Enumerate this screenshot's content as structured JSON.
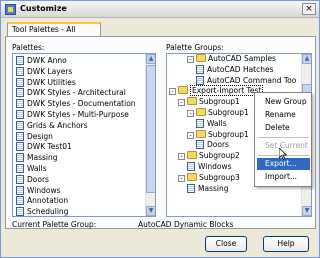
{
  "window": {
    "title": "Customize",
    "close_glyph": "×"
  },
  "tab": {
    "label": "Tool Palettes - All Palettes"
  },
  "palettes": {
    "label": "Palettes:",
    "items": [
      "DWK Anno",
      "DWK Layers",
      "DWK Utilities",
      "DWK Styles - Architectural",
      "DWK Styles - Documentation",
      "DWK Styles - Multi-Purpose",
      "Grids & Anchors",
      "Design",
      "DWK Test01",
      "Massing",
      "Walls",
      "Doors",
      "Windows",
      "Annotation",
      "Scheduling"
    ]
  },
  "groups": {
    "label": "Palette Groups:",
    "tree": [
      {
        "level": 3,
        "type": "folder",
        "expander": "-",
        "text": "AutoCAD Samples"
      },
      {
        "level": 4,
        "type": "palette",
        "text": "AutoCAD Hatches"
      },
      {
        "level": 4,
        "type": "palette",
        "text": "AutoCAD Command Too"
      },
      {
        "level": 1,
        "type": "folder",
        "expander": "-",
        "text": "Export-Import Test",
        "selected": true
      },
      {
        "level": 2,
        "type": "folder",
        "expander": "-",
        "text": "Subgroup1"
      },
      {
        "level": 3,
        "type": "folder",
        "expander": "-",
        "text": "Subgroup1"
      },
      {
        "level": 4,
        "type": "palette",
        "text": "Walls"
      },
      {
        "level": 3,
        "type": "folder",
        "expander": "-",
        "text": "Subgroup1"
      },
      {
        "level": 4,
        "type": "palette",
        "text": "Doors"
      },
      {
        "level": 2,
        "type": "folder",
        "expander": "-",
        "text": "Subgroup2"
      },
      {
        "level": 3,
        "type": "palette",
        "text": "Windows"
      },
      {
        "level": 2,
        "type": "folder",
        "expander": "-",
        "text": "Subgroup3"
      },
      {
        "level": 3,
        "type": "palette",
        "text": "Massing"
      }
    ]
  },
  "context_menu": {
    "items": [
      {
        "label": "New Group",
        "disabled": false
      },
      {
        "label": "Rename",
        "disabled": false
      },
      {
        "label": "Delete",
        "disabled": false
      },
      {
        "label": "Set Current",
        "disabled": true
      },
      {
        "label": "Export...",
        "disabled": false,
        "hover": true
      },
      {
        "label": "Import...",
        "disabled": false
      }
    ]
  },
  "footer": {
    "current_group_label": "Current Palette Group:",
    "current_group_value": "AutoCAD Dynamic Blocks"
  },
  "buttons": {
    "close": "Close",
    "help": "Help"
  }
}
